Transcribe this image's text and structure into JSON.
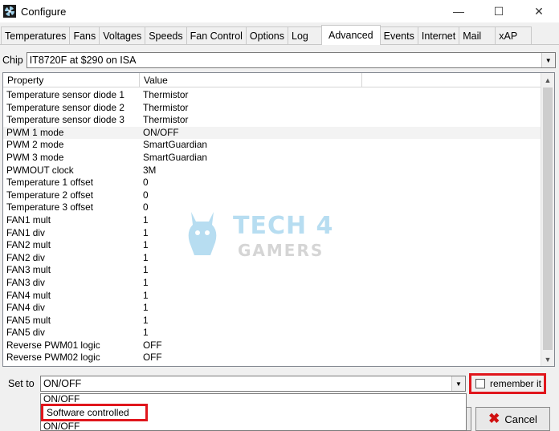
{
  "window": {
    "title": "Configure",
    "controls": {
      "minimize": "—",
      "maximize": "☐",
      "close": "✕"
    }
  },
  "tabs": [
    {
      "label": "Temperatures",
      "active": false
    },
    {
      "label": "Fans",
      "active": false
    },
    {
      "label": "Voltages",
      "active": false
    },
    {
      "label": "Speeds",
      "active": false
    },
    {
      "label": "Fan Control",
      "active": false
    },
    {
      "label": "Options",
      "active": false
    },
    {
      "label": "Log",
      "active": false
    },
    {
      "label": "Advanced",
      "active": true
    },
    {
      "label": "Events",
      "active": false
    },
    {
      "label": "Internet",
      "active": false
    },
    {
      "label": "Mail",
      "active": false
    },
    {
      "label": "xAP",
      "active": false
    }
  ],
  "chip": {
    "label": "Chip",
    "value": "IT8720F at $290 on ISA"
  },
  "table": {
    "headers": {
      "property": "Property",
      "value": "Value"
    },
    "rows": [
      {
        "property": "Temperature sensor diode 1",
        "value": "Thermistor"
      },
      {
        "property": "Temperature sensor diode 2",
        "value": "Thermistor"
      },
      {
        "property": "Temperature sensor diode 3",
        "value": "Thermistor"
      },
      {
        "property": "PWM 1 mode",
        "value": "ON/OFF",
        "selected": true
      },
      {
        "property": "PWM 2 mode",
        "value": "SmartGuardian"
      },
      {
        "property": "PWM 3 mode",
        "value": "SmartGuardian"
      },
      {
        "property": "PWMOUT clock",
        "value": "3M"
      },
      {
        "property": "Temperature 1 offset",
        "value": "0"
      },
      {
        "property": "Temperature 2 offset",
        "value": "0"
      },
      {
        "property": "Temperature 3 offset",
        "value": "0"
      },
      {
        "property": "FAN1 mult",
        "value": "1"
      },
      {
        "property": "FAN1 div",
        "value": "1"
      },
      {
        "property": "FAN2 mult",
        "value": "1"
      },
      {
        "property": "FAN2 div",
        "value": "1"
      },
      {
        "property": "FAN3 mult",
        "value": "1"
      },
      {
        "property": "FAN3 div",
        "value": "1"
      },
      {
        "property": "FAN4 mult",
        "value": "1"
      },
      {
        "property": "FAN4 div",
        "value": "1"
      },
      {
        "property": "FAN5 mult",
        "value": "1"
      },
      {
        "property": "FAN5 div",
        "value": "1"
      },
      {
        "property": "Reverse PWM01 logic",
        "value": "OFF"
      },
      {
        "property": "Reverse PWM02 logic",
        "value": "OFF"
      }
    ]
  },
  "watermark": {
    "top": "TECH 4",
    "bottom": "GAMERS"
  },
  "set_to": {
    "label": "Set to",
    "value": "ON/OFF",
    "options": [
      "ON/OFF",
      "Software controlled",
      "ON/OFF"
    ]
  },
  "remember": {
    "label": "remember it",
    "checked": false
  },
  "buttons": {
    "cancel": "Cancel"
  },
  "colors": {
    "highlight_box": "#e0161c",
    "watermark_blue": "#7ec3e6",
    "watermark_gray": "#b3b3b3"
  }
}
